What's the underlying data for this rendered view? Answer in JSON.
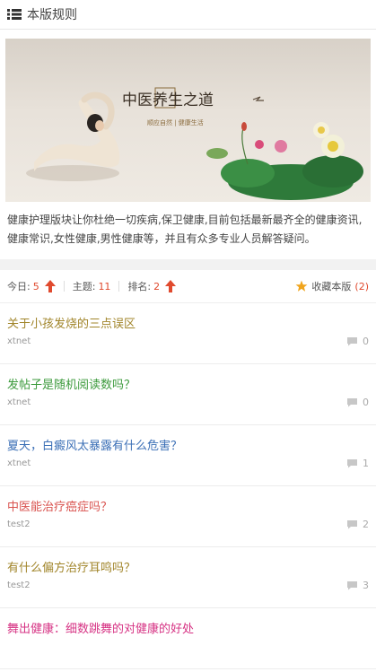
{
  "header": {
    "title": "本版规则"
  },
  "banner": {
    "calligraphy": "中医养生之道",
    "subtitle": "顺应自然 | 健康生活"
  },
  "description": "健康护理版块让你杜绝一切疾病,保卫健康,目前包括最新最齐全的健康资讯,健康常识,女性健康,男性健康等，并且有众多专业人员解答疑问。",
  "stats": {
    "today_label": "今日:",
    "today_value": "5",
    "topics_label": "主题:",
    "topics_value": "11",
    "rank_label": "排名:",
    "rank_value": "2",
    "favorite_label": "收藏本版",
    "favorite_count": "(2)"
  },
  "colors": {
    "accent_red": "#e04a2e",
    "olive": "#a1852a",
    "green": "#3c9a3c",
    "blue": "#3b6fb6",
    "red": "#d9534f",
    "magenta": "#d63384"
  },
  "threads": [
    {
      "title": "关于小孩发烧的三点误区",
      "author": "xtnet",
      "replies": "0",
      "color": "#a1852a"
    },
    {
      "title": "发帖子是随机阅读数吗？",
      "author": "xtnet",
      "replies": "0",
      "color": "#3c9a3c"
    },
    {
      "title": "夏天，白癜风太暴露有什么危害？",
      "author": "xtnet",
      "replies": "1",
      "color": "#3b6fb6"
    },
    {
      "title": "中医能治疗癌症吗？",
      "author": "test2",
      "replies": "2",
      "color": "#d9534f"
    },
    {
      "title": "有什么偏方治疗耳鸣吗？",
      "author": "test2",
      "replies": "3",
      "color": "#a1852a"
    },
    {
      "title": "舞出健康：细数跳舞的对健康的好处",
      "author": "",
      "replies": "",
      "color": "#d63384"
    }
  ]
}
